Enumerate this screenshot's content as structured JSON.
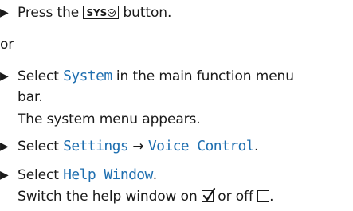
{
  "steps": {
    "step1": {
      "before": "Press the",
      "key_label": "SYS",
      "after": "button."
    },
    "or_text": "or",
    "step2": {
      "before": "Select",
      "menu_item": "System",
      "after": "in the main function menu",
      "line2": "bar.",
      "result": "The system menu appears."
    },
    "step3": {
      "before": "Select",
      "path_a": "Settings",
      "arrow": "→",
      "path_b": "Voice Control",
      "after": "."
    },
    "step4": {
      "before": "Select",
      "menu_item": "Help Window",
      "after": ".",
      "instruction_before": "Switch the help window on",
      "instruction_mid": "or off",
      "instruction_after": "."
    }
  },
  "icons": {
    "bullet": "bullet-triangle-icon",
    "sys_key": "sys-key-icon",
    "checked_box": "checkbox-checked-icon",
    "empty_box": "checkbox-empty-icon"
  },
  "colors": {
    "text": "#1a1a1a",
    "menu_item": "#1f6fb0"
  }
}
